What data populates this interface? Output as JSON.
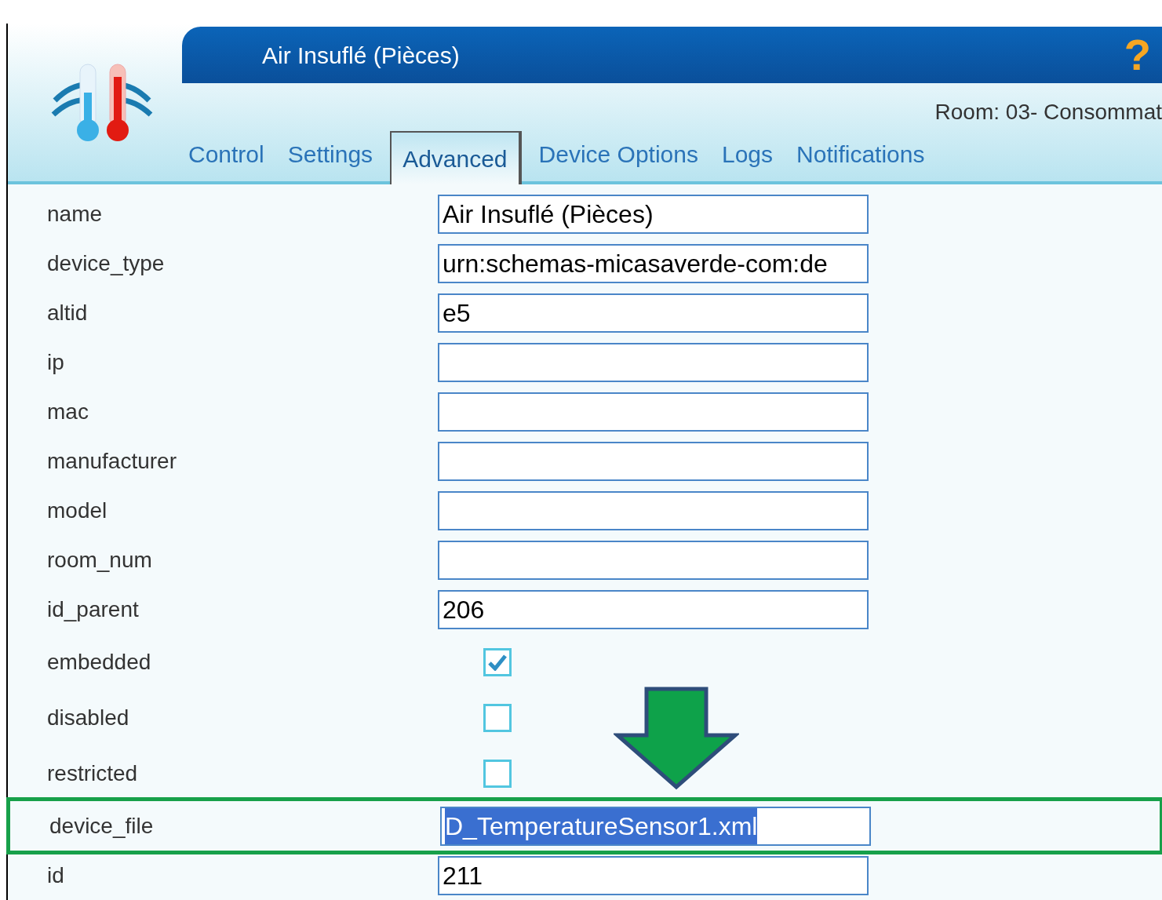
{
  "header": {
    "title": "Air Insuflé (Pièces)",
    "help": "?",
    "room": "Room: 03- Consommat"
  },
  "tabs": [
    {
      "label": "Control",
      "selected": false
    },
    {
      "label": "Settings",
      "selected": false
    },
    {
      "label": "Advanced",
      "selected": true
    },
    {
      "label": "Device Options",
      "selected": false
    },
    {
      "label": "Logs",
      "selected": false
    },
    {
      "label": "Notifications",
      "selected": false
    }
  ],
  "fields": [
    {
      "kind": "text",
      "label": "name",
      "value": "Air Insuflé (Pièces)"
    },
    {
      "kind": "text",
      "label": "device_type",
      "value": "urn:schemas-micasaverde-com:de"
    },
    {
      "kind": "text",
      "label": "altid",
      "value": "e5"
    },
    {
      "kind": "text",
      "label": "ip"
    },
    {
      "kind": "text",
      "label": "mac"
    },
    {
      "kind": "text",
      "label": "manufacturer"
    },
    {
      "kind": "text",
      "label": "model"
    },
    {
      "kind": "text",
      "label": "room_num"
    },
    {
      "kind": "text",
      "label": "id_parent",
      "value": "206"
    },
    {
      "kind": "checkbox",
      "label": "embedded",
      "checked": true
    },
    {
      "kind": "checkbox",
      "label": "disabled",
      "checked": false
    },
    {
      "kind": "checkbox",
      "label": "restricted",
      "checked": false
    },
    {
      "kind": "text",
      "label": "device_file",
      "value": "D_TemperatureSensor1.xml",
      "highlighted": true,
      "text_selected": true
    },
    {
      "kind": "text",
      "label": "id",
      "value": "211"
    }
  ]
}
